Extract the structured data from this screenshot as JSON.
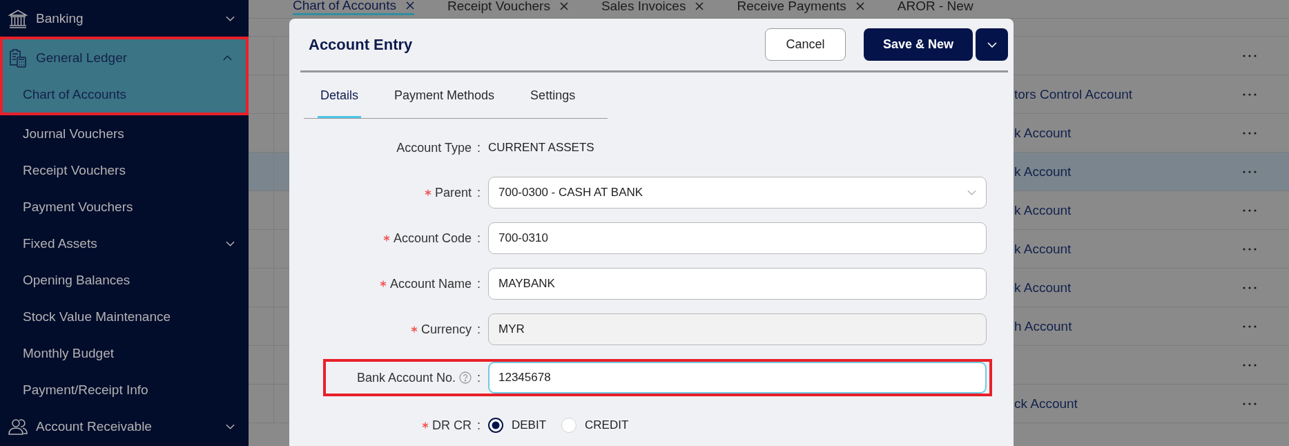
{
  "sidebar": {
    "items": [
      {
        "label": "Banking",
        "expanded": false,
        "selected": false,
        "highlighted": false
      },
      {
        "label": "General Ledger",
        "expanded": true,
        "selected": true,
        "highlighted": true,
        "children": [
          {
            "label": "Chart of Accounts",
            "selected": true,
            "highlighted": true
          },
          {
            "label": "Journal Vouchers",
            "selected": false,
            "highlighted": false
          },
          {
            "label": "Receipt Vouchers",
            "selected": false,
            "highlighted": false
          },
          {
            "label": "Payment Vouchers",
            "selected": false,
            "highlighted": false
          },
          {
            "label": "Fixed Assets",
            "expanded": false,
            "selected": false,
            "highlighted": false
          },
          {
            "label": "Opening Balances",
            "selected": false,
            "highlighted": false
          },
          {
            "label": "Stock Value Maintenance",
            "selected": false,
            "highlighted": false
          },
          {
            "label": "Monthly Budget",
            "selected": false,
            "highlighted": false
          },
          {
            "label": "Payment/Receipt Info",
            "selected": false,
            "highlighted": false
          }
        ]
      },
      {
        "label": "Account Receivable",
        "expanded": false,
        "selected": false,
        "highlighted": false
      }
    ]
  },
  "tabs": [
    {
      "label": "Chart of Accounts",
      "selected": true,
      "closable": true
    },
    {
      "label": "Receipt Vouchers",
      "selected": false,
      "closable": true
    },
    {
      "label": "Sales Invoices",
      "selected": false,
      "closable": true
    },
    {
      "label": "Receive Payments",
      "selected": false,
      "closable": true
    },
    {
      "label": "AROR - New",
      "selected": false,
      "closable": false
    }
  ],
  "table": {
    "rows": [
      {
        "column_1": "",
        "selected": false
      },
      {
        "column_1": "tors Control Account",
        "selected": false
      },
      {
        "column_1": "k Account",
        "selected": false
      },
      {
        "column_1": "k Account",
        "selected": true
      },
      {
        "column_1": "k Account",
        "selected": false
      },
      {
        "column_1": "k Account",
        "selected": false
      },
      {
        "column_1": "k Account",
        "selected": false
      },
      {
        "column_1": "h Account",
        "selected": false
      },
      {
        "column_1": "",
        "selected": false
      },
      {
        "column_1": "ck Account",
        "selected": false
      }
    ]
  },
  "dialog": {
    "title": "Account Entry",
    "buttons": [
      {
        "label": "Cancel",
        "kind": "secondary"
      },
      {
        "label": "Save & New",
        "kind": "primary"
      },
      {
        "kind": "dropdown"
      }
    ],
    "tabs": [
      {
        "label": "Details",
        "selected": true
      },
      {
        "label": "Payment Methods",
        "selected": false
      },
      {
        "label": "Settings",
        "selected": false
      }
    ],
    "fields": [
      {
        "kind": "text",
        "label": "Account Type",
        "separator": ":",
        "required": false,
        "value": "CURRENT ASSETS"
      },
      {
        "kind": "select",
        "label": "Parent",
        "separator": ":",
        "required": true,
        "value": "700-0300 - CASH AT BANK",
        "highlighted": false,
        "help": false
      },
      {
        "kind": "input",
        "label": "Account Code",
        "separator": ":",
        "required": true,
        "value": "700-0310",
        "focused": false,
        "highlighted": false,
        "help": false
      },
      {
        "kind": "input",
        "label": "Account Name",
        "separator": ":",
        "required": true,
        "value": "MAYBANK",
        "focused": false,
        "highlighted": false,
        "help": false
      },
      {
        "kind": "readonly",
        "label": "Currency",
        "separator": ":",
        "required": true,
        "value": "MYR",
        "highlighted": false,
        "help": false
      },
      {
        "kind": "input",
        "label": "Bank Account No.",
        "separator": ":",
        "required": false,
        "value": "12345678",
        "focused": true,
        "highlighted": true,
        "help": true
      },
      {
        "kind": "radio",
        "label": "DR CR",
        "separator": ":",
        "required": true,
        "options": [
          {
            "label": "DEBIT",
            "selected": true
          },
          {
            "label": "CREDIT",
            "selected": false
          }
        ]
      }
    ]
  }
}
